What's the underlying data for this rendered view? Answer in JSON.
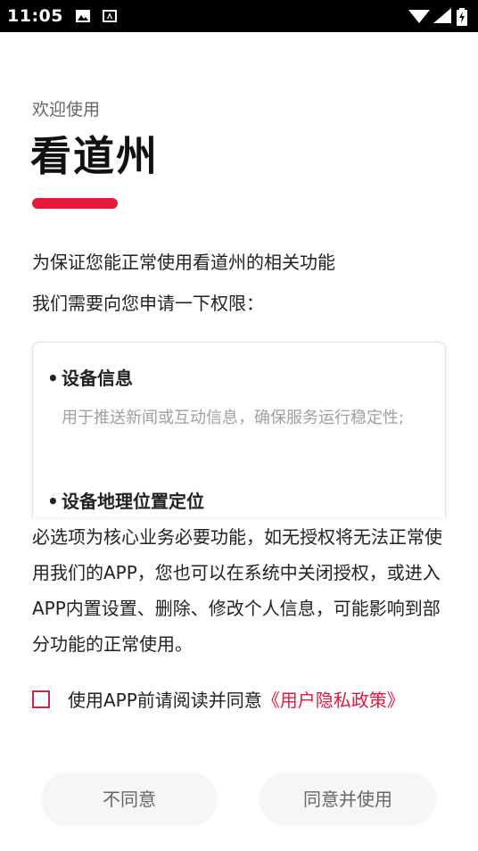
{
  "status_bar": {
    "time": "11:05"
  },
  "header": {
    "welcome": "欢迎使用",
    "app_name": "看道州"
  },
  "intro": {
    "line1": "为保证您能正常使用看道州的相关功能",
    "line2": "我们需要向您申请一下权限："
  },
  "permissions": [
    {
      "bullet": "•",
      "title": "设备信息",
      "description": "用于推送新闻或互动信息，确保服务运行稳定性;"
    },
    {
      "bullet": "•",
      "title": "设备地理位置定位",
      "description": ""
    }
  ],
  "notice": "必选项为核心业务必要功能，如无授权将无法正常使用我们的APP，您也可以在系统中关闭授权，或进入APP内置设置、删除、修改个人信息，可能影响到部分功能的正常使用。",
  "agreement": {
    "checked": false,
    "text": "使用APP前请阅读并同意",
    "policy_link": "《用户隐私政策》"
  },
  "buttons": {
    "disagree": "不同意",
    "agree": "同意并使用"
  },
  "colors": {
    "accent": "#e8173c",
    "status_bar": "#000000",
    "button_bg": "#f6f6f6"
  }
}
